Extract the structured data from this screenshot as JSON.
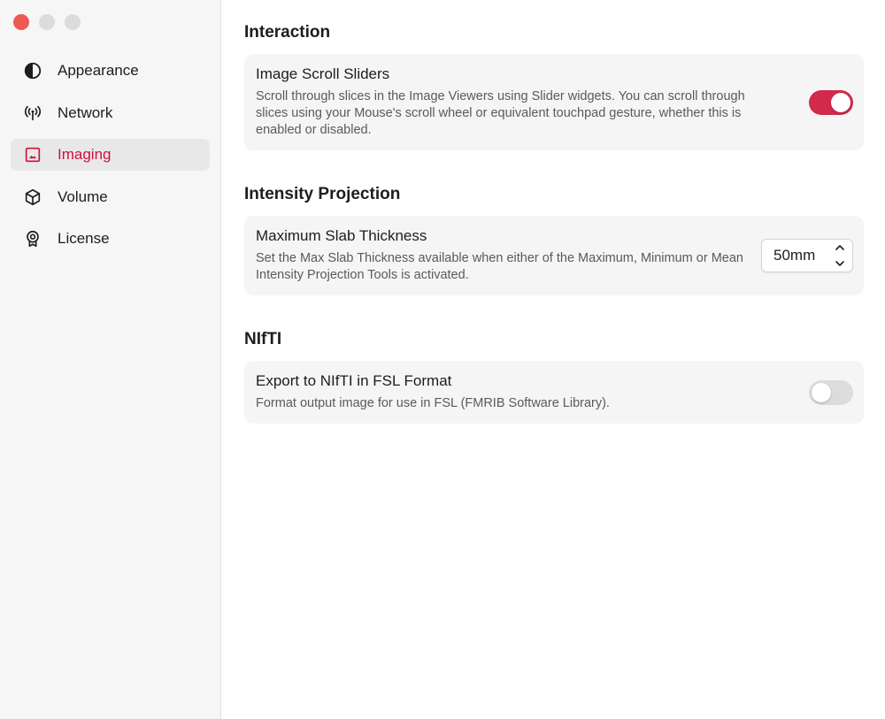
{
  "sidebar": {
    "items": [
      {
        "label": "Appearance",
        "icon": "half-circle-icon",
        "active": false
      },
      {
        "label": "Network",
        "icon": "antenna-icon",
        "active": false
      },
      {
        "label": "Imaging",
        "icon": "image-icon",
        "active": true
      },
      {
        "label": "Volume",
        "icon": "cube-icon",
        "active": false
      },
      {
        "label": "License",
        "icon": "award-icon",
        "active": false
      }
    ]
  },
  "colors": {
    "accent": "#d0103a",
    "toggle_on": "#d22a4b",
    "traffic_close": "#ee5a52",
    "traffic_min": "#dcdcdc",
    "traffic_max": "#dcdcdc"
  },
  "sections": {
    "interaction": {
      "title": "Interaction",
      "scroll_sliders": {
        "title": "Image Scroll Sliders",
        "description": "Scroll through slices in the Image Viewers using Slider widgets. You can scroll through slices using your Mouse's scroll wheel or equivalent touchpad gesture, whether this is enabled or disabled.",
        "enabled": true
      }
    },
    "intensity_projection": {
      "title": "Intensity Projection",
      "slab_thickness": {
        "title": "Maximum Slab Thickness",
        "description": "Set the Max Slab Thickness available when either of the Maximum, Minimum or Mean Intensity Projection Tools is activated.",
        "value": "50mm"
      }
    },
    "nifti": {
      "title": "NIfTI",
      "export_fsl": {
        "title": "Export to NIfTI in FSL Format",
        "description": "Format output image for use in FSL (FMRIB Software Library).",
        "enabled": false
      }
    }
  }
}
